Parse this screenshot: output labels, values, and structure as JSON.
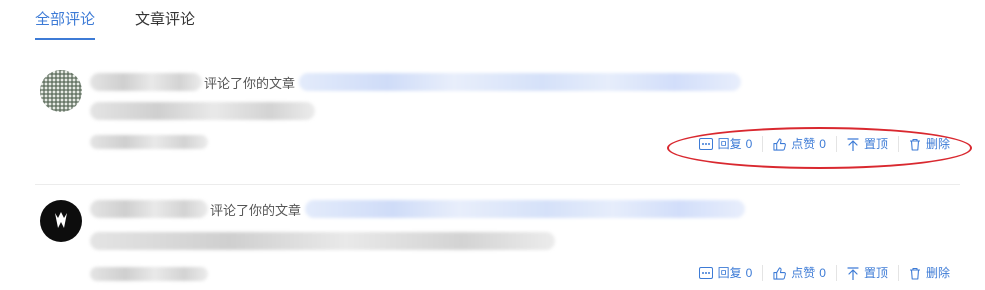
{
  "tabs": [
    {
      "label": "全部评论",
      "active": true
    },
    {
      "label": "文章评论",
      "active": false
    }
  ],
  "comments": [
    {
      "action_text": "评论了你的文章",
      "avatar": "pattern-avatar",
      "actions": {
        "reply_label": "回复",
        "reply_count": "0",
        "like_label": "点赞",
        "like_count": "0",
        "pin_label": "置顶",
        "delete_label": "删除"
      }
    },
    {
      "action_text": "评论了你的文章",
      "avatar": "dark-avatar",
      "actions": {
        "reply_label": "回复",
        "reply_count": "0",
        "like_label": "点赞",
        "like_count": "0",
        "pin_label": "置顶",
        "delete_label": "删除"
      }
    }
  ],
  "colors": {
    "accent": "#3d7bd6",
    "annotation": "#d9282f",
    "text": "#555555"
  },
  "icons": [
    "more-dots-icon",
    "thumbs-up-icon",
    "pin-top-icon",
    "trash-icon"
  ]
}
